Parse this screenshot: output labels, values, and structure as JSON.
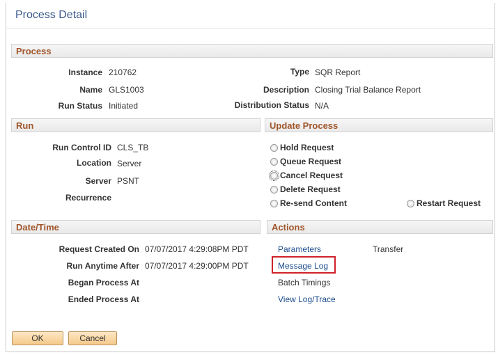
{
  "page": {
    "title": "Process Detail"
  },
  "process": {
    "header": "Process",
    "instance_label": "Instance",
    "instance_value": "210762",
    "name_label": "Name",
    "name_value": "GLS1003",
    "run_status_label": "Run Status",
    "run_status_value": "Initiated",
    "type_label": "Type",
    "type_value": "SQR Report",
    "description_label": "Description",
    "description_value": "Closing Trial Balance Report",
    "distribution_label": "Distribution Status",
    "distribution_value": "N/A"
  },
  "run": {
    "header": "Run",
    "run_control_label": "Run Control ID",
    "run_control_value": "CLS_TB",
    "location_label": "Location",
    "location_value": "Server",
    "server_label": "Server",
    "server_value": "PSNT",
    "recurrence_label": "Recurrence",
    "recurrence_value": ""
  },
  "update_process": {
    "header": "Update Process",
    "options": [
      "Hold Request",
      "Queue Request",
      "Cancel Request",
      "Delete Request",
      "Re-send Content",
      "Restart Request"
    ]
  },
  "datetime": {
    "header": "Date/Time",
    "request_created_label": "Request Created On",
    "request_created_value": "07/07/2017  4:29:08PM PDT",
    "run_anytime_label": "Run Anytime After",
    "run_anytime_value": "07/07/2017  4:29:00PM PDT",
    "began_label": "Began Process At",
    "began_value": "",
    "ended_label": "Ended Process At",
    "ended_value": ""
  },
  "actions": {
    "header": "Actions",
    "parameters": "Parameters",
    "transfer": "Transfer",
    "message_log": "Message Log",
    "batch_timings": "Batch Timings",
    "view_log": "View Log/Trace"
  },
  "buttons": {
    "ok": "OK",
    "cancel": "Cancel"
  },
  "colors": {
    "section_title": "#a0562a",
    "link": "#1d4d8c",
    "highlight": "#d0202a",
    "button": "#f5c98a"
  }
}
